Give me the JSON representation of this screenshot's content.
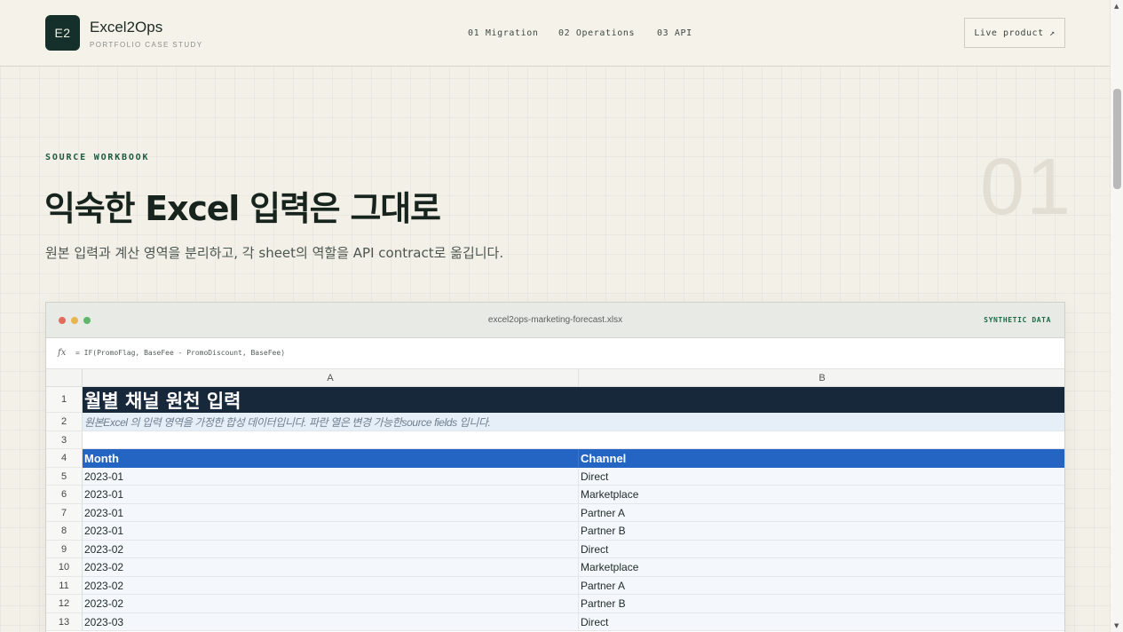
{
  "header": {
    "logo_text": "E2",
    "brand_name": "Excel2Ops",
    "brand_sub": "PORTFOLIO CASE STUDY",
    "nav": [
      "01 Migration",
      "02 Operations",
      "03 API"
    ],
    "cta_label": "Live product ↗"
  },
  "section": {
    "eyebrow": "SOURCE WORKBOOK",
    "number": "01",
    "headline": "익숙한 Excel 입력은 그대로",
    "subline": "원본 입력과 계산 영역을 분리하고, 각 sheet의 역할을 API contract로 옮깁니다."
  },
  "workbook": {
    "filename": "excel2ops-marketing-forecast.xlsx",
    "badge": "SYNTHETIC DATA",
    "fx_symbol": "fx",
    "formula": "= IF(PromoFlag, BaseFee - PromoDiscount, BaseFee)",
    "columns": [
      "A",
      "B"
    ],
    "rows": [
      {
        "num": "1",
        "a": "월별 채널 원천 입력"
      },
      {
        "num": "2",
        "a": "원본Excel 의 입력 영역을 가정한 합성 데이터입니다. 파란 열은 변경 가능한source fields 입니다."
      },
      {
        "num": "3",
        "a": ""
      },
      {
        "num": "4",
        "a": "Month",
        "b": "Channel"
      },
      {
        "num": "5",
        "a": "2023-01",
        "b": "Direct"
      },
      {
        "num": "6",
        "a": "2023-01",
        "b": "Marketplace"
      },
      {
        "num": "7",
        "a": "2023-01",
        "b": "Partner A"
      },
      {
        "num": "8",
        "a": "2023-01",
        "b": "Partner B"
      },
      {
        "num": "9",
        "a": "2023-02",
        "b": "Direct"
      },
      {
        "num": "10",
        "a": "2023-02",
        "b": "Marketplace"
      },
      {
        "num": "11",
        "a": "2023-02",
        "b": "Partner A"
      },
      {
        "num": "12",
        "a": "2023-02",
        "b": "Partner B"
      },
      {
        "num": "13",
        "a": "2023-03",
        "b": "Direct"
      }
    ]
  },
  "colors": {
    "accent_green": "#1d5a3e",
    "title_row": "#17283b",
    "header_row": "#2464c2",
    "note_row": "#e6eef7"
  }
}
